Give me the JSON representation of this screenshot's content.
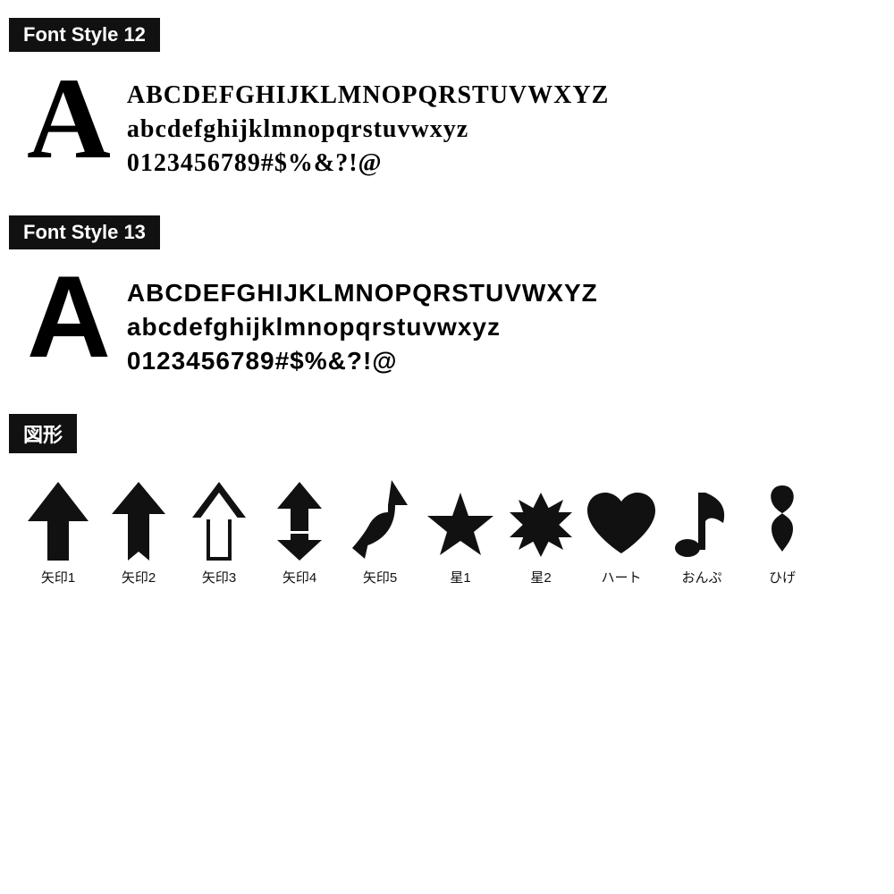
{
  "font_style_12": {
    "label": "Font Style 12",
    "big_letter": "A",
    "line1": "ABCDEFGHIJKLMNOPQRSTUVWXYZ",
    "line2": "abcdefghijklmnopqrstuvwxyz",
    "line3": "0123456789#$%&?!@"
  },
  "font_style_13": {
    "label": "Font Style 13",
    "big_letter": "A",
    "line1": "ABCDEFGHIJKLMNOPQRSTUVWXYZ",
    "line2": "abcdefghijklmnopqrstuvwxyz",
    "line3": "0123456789#$%&?!@"
  },
  "shapes_section": {
    "label": "図形",
    "shapes": [
      {
        "name": "矢印1",
        "type": "arrow1"
      },
      {
        "name": "矢印2",
        "type": "arrow2"
      },
      {
        "name": "矢印3",
        "type": "arrow3"
      },
      {
        "name": "矢印4",
        "type": "arrow4"
      },
      {
        "name": "矢印5",
        "type": "arrow5"
      },
      {
        "name": "星1",
        "type": "star1"
      },
      {
        "name": "星2",
        "type": "star2"
      },
      {
        "name": "ハート",
        "type": "heart"
      },
      {
        "name": "おんぷ",
        "type": "music"
      },
      {
        "name": "ひげ",
        "type": "moustache"
      }
    ]
  }
}
